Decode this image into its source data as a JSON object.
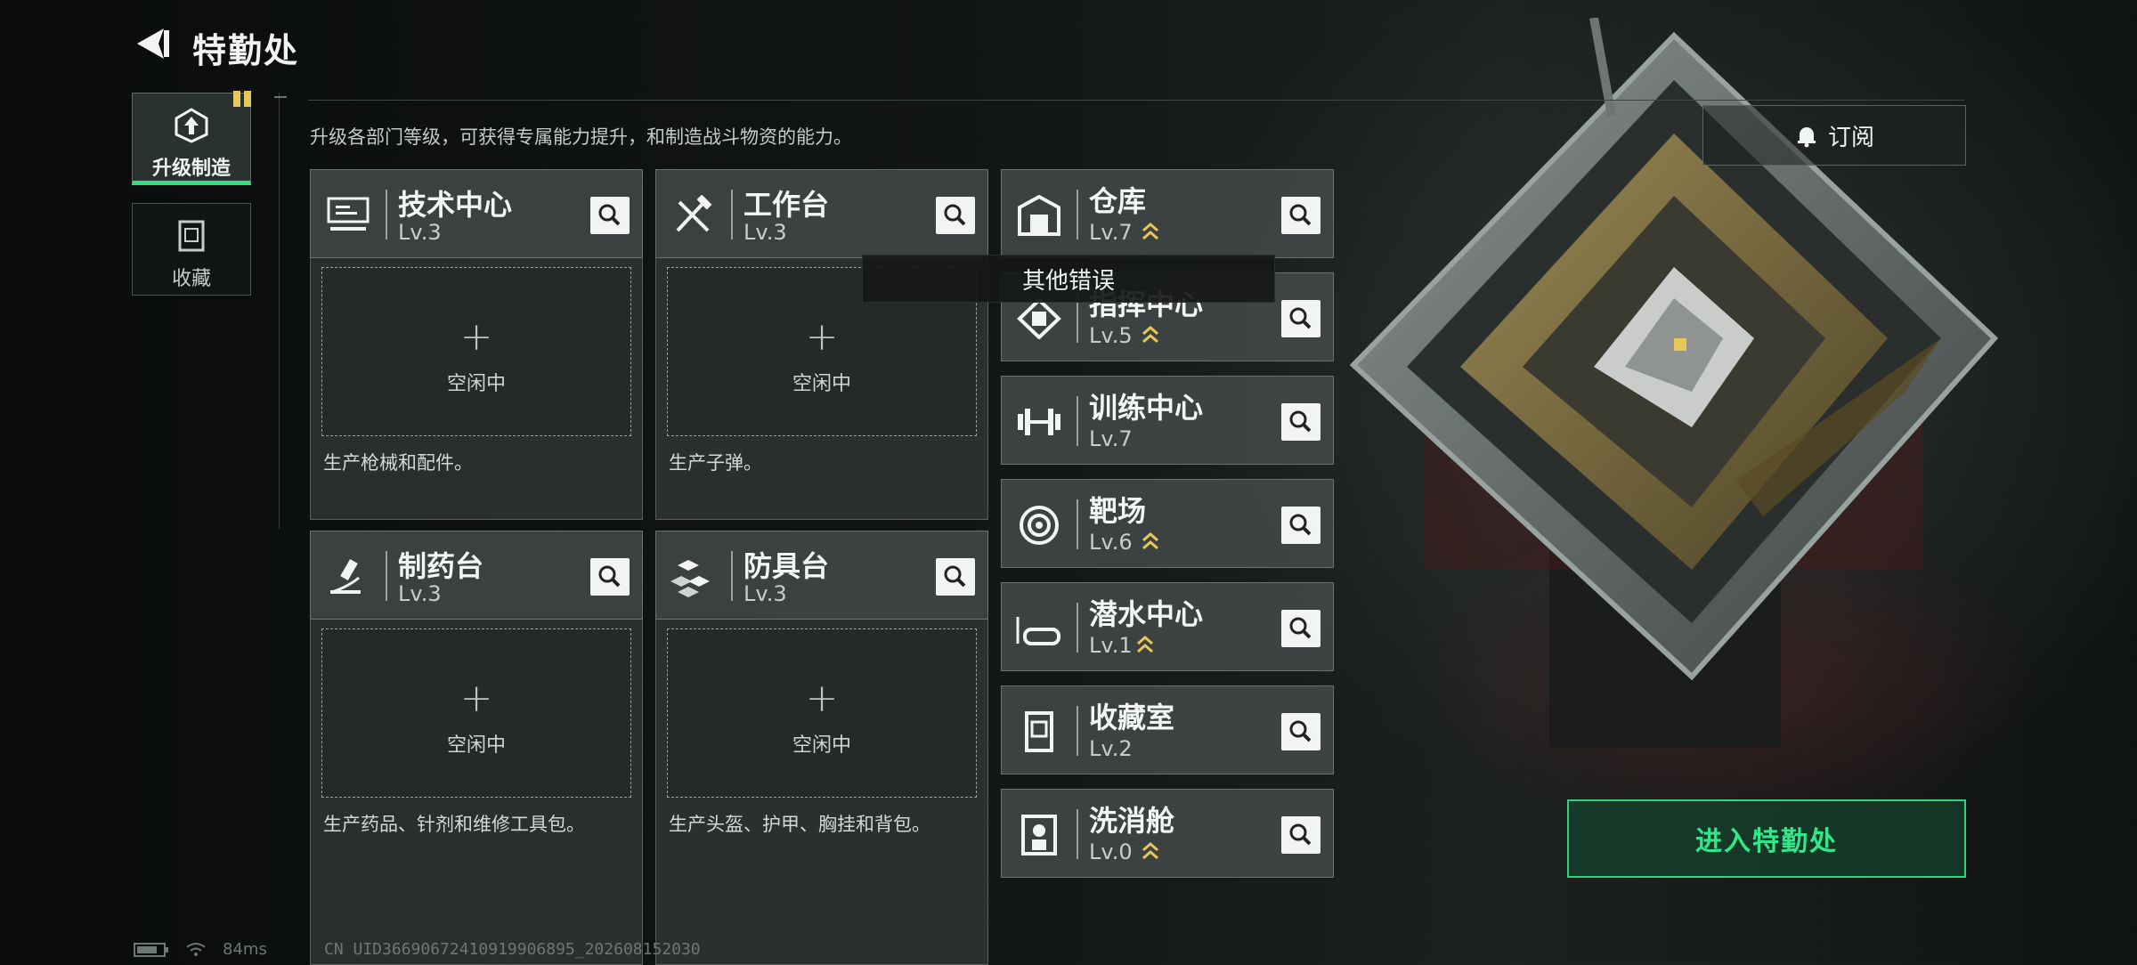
{
  "header": {
    "title": "特勤处"
  },
  "nav": {
    "items": [
      {
        "label": "升级制造",
        "active": true
      },
      {
        "label": "收藏",
        "active": false
      }
    ]
  },
  "description": "升级各部门等级，可获得专属能力提升，和制造战斗物资的能力。",
  "subscribe_label": "订阅",
  "workshops": [
    {
      "name": "技术中心",
      "level": "Lv.3",
      "slot_status": "空闲中",
      "produces": "生产枪械和配件。",
      "icon": "monitor-icon"
    },
    {
      "name": "工作台",
      "level": "Lv.3",
      "slot_status": "空闲中",
      "produces": "生产子弹。",
      "icon": "hammer-wrench-icon"
    },
    {
      "name": "制药台",
      "level": "Lv.3",
      "slot_status": "空闲中",
      "produces": "生产药品、针剂和维修工具包。",
      "icon": "microscope-icon"
    },
    {
      "name": "防具台",
      "level": "Lv.3",
      "slot_status": "空闲中",
      "produces": "生产头盔、护甲、胸挂和背包。",
      "icon": "armor-blocks-icon"
    }
  ],
  "facilities": [
    {
      "name": "仓库",
      "level": "Lv.7",
      "upgradable": true,
      "icon": "warehouse-icon"
    },
    {
      "name": "指挥中心",
      "level": "Lv.5",
      "upgradable": true,
      "icon": "command-chip-icon"
    },
    {
      "name": "训练中心",
      "level": "Lv.7",
      "upgradable": false,
      "icon": "dumbbell-icon"
    },
    {
      "name": "靶场",
      "level": "Lv.6",
      "upgradable": true,
      "icon": "target-icon"
    },
    {
      "name": "潜水中心",
      "level": "Lv.1",
      "upgradable": true,
      "icon": "diving-mask-icon"
    },
    {
      "name": "收藏室",
      "level": "Lv.2",
      "upgradable": false,
      "icon": "collection-case-icon"
    },
    {
      "name": "洗消舱",
      "level": "Lv.0",
      "upgradable": true,
      "icon": "hazmat-icon"
    }
  ],
  "tooltip": "其他错误",
  "enter_button": "进入特勤处",
  "status_bar": {
    "ping": "84ms",
    "uid": "CN UID36690672410919906895_202608152030"
  },
  "colors": {
    "accent": "#2fe07f",
    "upgrade": "#e7c65a"
  }
}
